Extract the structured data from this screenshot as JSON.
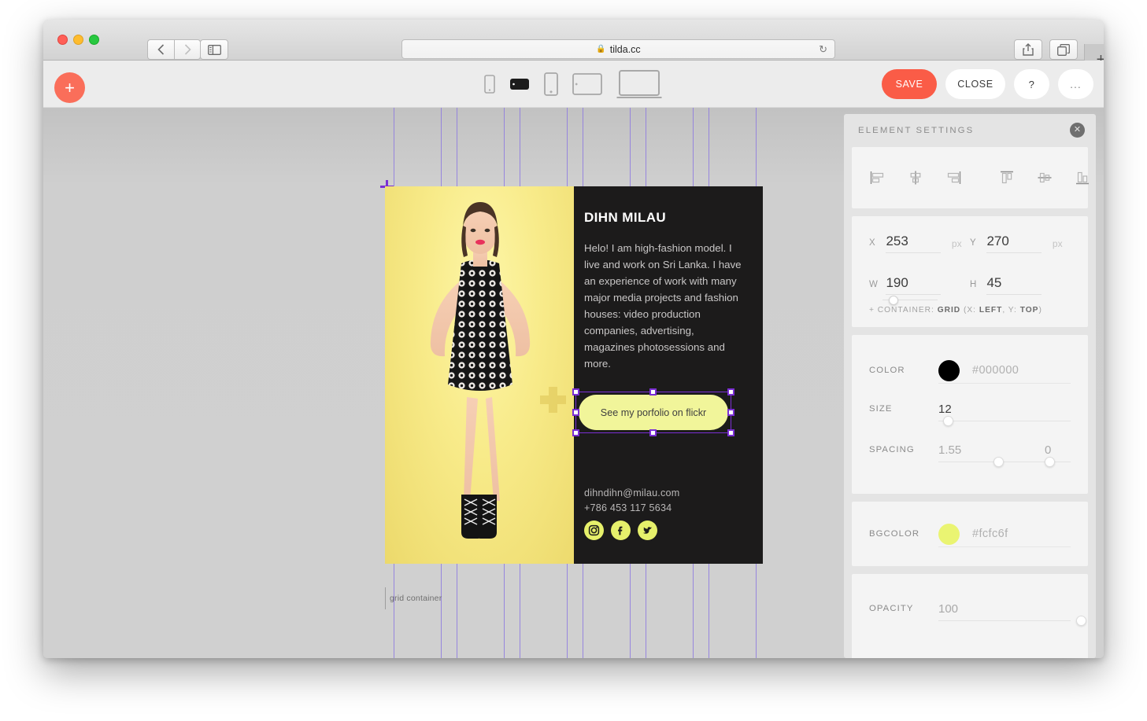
{
  "browser": {
    "url": "tilda.cc",
    "lock_icon": "lock-icon",
    "reload_icon": "reload-icon",
    "back_icon": "chevron-left-icon",
    "forward_icon": "chevron-right-icon",
    "sidebar_icon": "sidebar-toggle-icon",
    "share_icon": "share-icon",
    "tabs_icon": "show-tabs-icon",
    "newtab_label": "+"
  },
  "editor": {
    "add_block_label": "+",
    "devices": [
      {
        "name": "phone-small",
        "selected": false
      },
      {
        "name": "phone-landscape",
        "selected": true
      },
      {
        "name": "phone-portrait",
        "selected": false
      },
      {
        "name": "tablet-landscape",
        "selected": false
      },
      {
        "name": "laptop",
        "selected": false
      }
    ],
    "save_label": "SAVE",
    "close_label": "CLOSE",
    "help_label": "?",
    "more_label": "...",
    "save_color": "#fa5c47"
  },
  "canvas": {
    "grid_container_label": "grid container",
    "guides_x": [
      500,
      560,
      580,
      640,
      660,
      720,
      740,
      800,
      820,
      880,
      900,
      960
    ],
    "guide_color": "#8d79e0",
    "selection_color": "#7b2fd4"
  },
  "card": {
    "title": "DIHN MILAU",
    "bio": "Helo! I am high-fashion model. I live and work on Sri Lanka. I have an experience of work with many major media projects and fashion houses: video production companies, advertising, magazines photosessions and more.",
    "cta_label": "See my porfolio on flickr",
    "email": "dihndihn@milau.com",
    "phone": "+786 453 117 5634",
    "socials": [
      {
        "name": "instagram-icon"
      },
      {
        "name": "facebook-icon"
      },
      {
        "name": "twitter-icon"
      }
    ],
    "bg_dark": "#1c1b1b",
    "cta_bg": "#f1f59a",
    "social_bg": "#e6f06b"
  },
  "panel": {
    "title": "ELEMENT SETTINGS",
    "close_icon": "close-icon",
    "align_buttons": [
      {
        "name": "align-left-icon"
      },
      {
        "name": "align-center-horizontal-icon"
      },
      {
        "name": "align-right-icon"
      },
      {
        "name": "align-top-icon"
      },
      {
        "name": "align-middle-vertical-icon"
      },
      {
        "name": "align-bottom-icon"
      }
    ],
    "geometry": {
      "x_label": "X",
      "x_value": "253",
      "x_unit": "px",
      "y_label": "Y",
      "y_value": "270",
      "y_unit": "px",
      "w_label": "W",
      "w_value": "190",
      "h_label": "H",
      "h_value": "45",
      "container_prefix": "+ CONTAINER: ",
      "container_type": "GRID",
      "container_params": " (X: ",
      "container_x": "LEFT",
      "container_params2": ",  Y: ",
      "container_y": "TOP",
      "container_suffix": ")"
    },
    "color": {
      "label": "COLOR",
      "value": "#000000",
      "swatch": "#000000"
    },
    "size": {
      "label": "SIZE",
      "value": "12"
    },
    "spacing": {
      "label": "SPACING",
      "value1": "1.55",
      "value2": "0"
    },
    "bgcolor": {
      "label": "BGCOLOR",
      "value": "#fcfc6f",
      "swatch": "#eaf472"
    },
    "opacity": {
      "label": "OPACITY",
      "value": "100"
    }
  }
}
